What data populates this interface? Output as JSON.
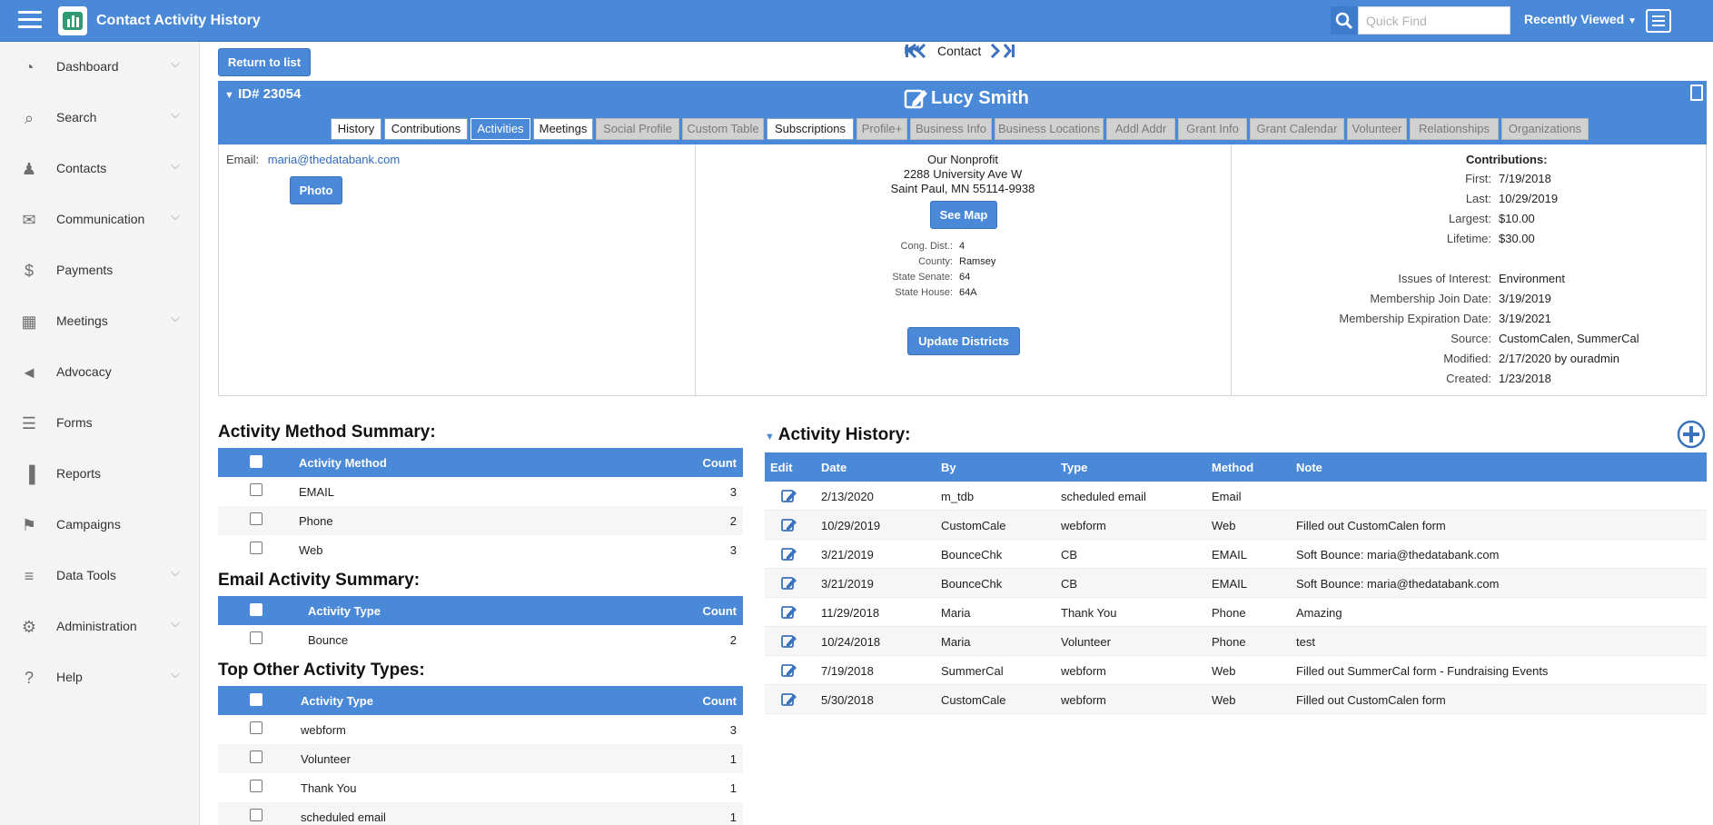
{
  "app": {
    "title": "Contact Activity History"
  },
  "search": {
    "placeholder": "Quick Find"
  },
  "header": {
    "recently_viewed": "Recently Viewed"
  },
  "sidebar": {
    "items": [
      {
        "label": "Dashboard",
        "icon": "dashboard-icon",
        "chevron": true
      },
      {
        "label": "Search",
        "icon": "search-icon",
        "chevron": true
      },
      {
        "label": "Contacts",
        "icon": "users-icon",
        "chevron": true
      },
      {
        "label": "Communication",
        "icon": "envelope-icon",
        "chevron": true
      },
      {
        "label": "Payments",
        "icon": "dollar-icon",
        "chevron": false
      },
      {
        "label": "Meetings",
        "icon": "calendar-icon",
        "chevron": true
      },
      {
        "label": "Advocacy",
        "icon": "megaphone-icon",
        "chevron": false
      },
      {
        "label": "Forms",
        "icon": "form-icon",
        "chevron": false
      },
      {
        "label": "Reports",
        "icon": "bar-chart-icon",
        "chevron": false
      },
      {
        "label": "Campaigns",
        "icon": "flag-icon",
        "chevron": false
      },
      {
        "label": "Data Tools",
        "icon": "database-icon",
        "chevron": true
      },
      {
        "label": "Administration",
        "icon": "gear-icon",
        "chevron": true
      },
      {
        "label": "Help",
        "icon": "question-icon",
        "chevron": true
      }
    ]
  },
  "toolbar": {
    "return_label": "Return to list",
    "pager_label": "Contact"
  },
  "contact": {
    "id_label": "ID# 23054",
    "name": "Lucy Smith",
    "email_label": "Email:",
    "email": "maria@thedatabank.com",
    "photo_label": "Photo",
    "org": "Our Nonprofit",
    "address1": "2288 University Ave W",
    "address2": "Saint Paul, MN 55114-9938",
    "see_map_label": "See Map",
    "districts": [
      {
        "label": "Cong. Dist.:",
        "value": "4"
      },
      {
        "label": "County:",
        "value": "Ramsey"
      },
      {
        "label": "State Senate:",
        "value": "64"
      },
      {
        "label": "State House:",
        "value": "64A"
      }
    ],
    "update_districts_label": "Update Districts",
    "contributions_title": "Contributions:",
    "contributions": [
      {
        "label": "First:",
        "value": "7/19/2018"
      },
      {
        "label": "Last:",
        "value": "10/29/2019"
      },
      {
        "label": "Largest:",
        "value": "$10.00"
      },
      {
        "label": "Lifetime:",
        "value": "$30.00"
      }
    ],
    "info": [
      {
        "label": "Issues of Interest:",
        "value": "Environment"
      },
      {
        "label": "Membership Join Date:",
        "value": "3/19/2019"
      },
      {
        "label": "Membership Expiration Date:",
        "value": "3/19/2021"
      },
      {
        "label": "Source:",
        "value": "CustomCalen, SummerCal"
      },
      {
        "label": "Modified:",
        "value": "2/17/2020 by ouradmin"
      },
      {
        "label": "Created:",
        "value": "1/23/2018"
      }
    ]
  },
  "tabs": [
    {
      "label": "History",
      "state": "on"
    },
    {
      "label": "Contributions",
      "state": "on"
    },
    {
      "label": "Activities",
      "state": "active"
    },
    {
      "label": "Meetings",
      "state": "on"
    },
    {
      "label": "Social Profile",
      "state": "off"
    },
    {
      "label": "Custom Table",
      "state": "off"
    },
    {
      "label": "Subscriptions",
      "state": "on"
    },
    {
      "label": "Profile+",
      "state": "off"
    },
    {
      "label": "Business Info",
      "state": "off"
    },
    {
      "label": "Business Locations",
      "state": "off"
    },
    {
      "label": "Addl Addr",
      "state": "off"
    },
    {
      "label": "Grant Info",
      "state": "off"
    },
    {
      "label": "Grant Calendar",
      "state": "off"
    },
    {
      "label": "Volunteer",
      "state": "off"
    },
    {
      "label": "Relationships",
      "state": "off"
    },
    {
      "label": "Organizations",
      "state": "off"
    }
  ],
  "method_summary": {
    "title": "Activity Method Summary:",
    "col_name": "Activity Method",
    "col_count": "Count",
    "rows": [
      {
        "name": "EMAIL",
        "count": "3"
      },
      {
        "name": "Phone",
        "count": "2"
      },
      {
        "name": "Web",
        "count": "3"
      }
    ]
  },
  "email_summary": {
    "title": "Email Activity Summary:",
    "col_name": "Activity Type",
    "col_count": "Count",
    "rows": [
      {
        "name": "Bounce",
        "count": "2"
      }
    ]
  },
  "other_summary": {
    "title": "Top Other Activity Types:",
    "col_name": "Activity Type",
    "col_count": "Count",
    "rows": [
      {
        "name": "webform",
        "count": "3"
      },
      {
        "name": "Volunteer",
        "count": "1"
      },
      {
        "name": "Thank You",
        "count": "1"
      },
      {
        "name": "scheduled email",
        "count": "1"
      }
    ]
  },
  "history": {
    "title": "Activity History:",
    "columns": [
      "Edit",
      "Date",
      "By",
      "Type",
      "Method",
      "Note"
    ],
    "rows": [
      {
        "date": "2/13/2020",
        "by": "m_tdb",
        "type": "scheduled email",
        "method": "Email",
        "note": ""
      },
      {
        "date": "10/29/2019",
        "by": "CustomCale",
        "type": "webform",
        "method": "Web",
        "note": "Filled out CustomCalen form"
      },
      {
        "date": "3/21/2019",
        "by": "BounceChk",
        "type": "CB",
        "method": "EMAIL",
        "note": "Soft Bounce: maria@thedatabank.com"
      },
      {
        "date": "3/21/2019",
        "by": "BounceChk",
        "type": "CB",
        "method": "EMAIL",
        "note": "Soft Bounce: maria@thedatabank.com"
      },
      {
        "date": "11/29/2018",
        "by": "Maria",
        "type": "Thank You",
        "method": "Phone",
        "note": "Amazing"
      },
      {
        "date": "10/24/2018",
        "by": "Maria",
        "type": "Volunteer",
        "method": "Phone",
        "note": "test"
      },
      {
        "date": "7/19/2018",
        "by": "SummerCal",
        "type": "webform",
        "method": "Web",
        "note": "Filled out SummerCal form - Fundraising Events"
      },
      {
        "date": "5/30/2018",
        "by": "CustomCale",
        "type": "webform",
        "method": "Web",
        "note": "Filled out CustomCalen form"
      }
    ]
  }
}
